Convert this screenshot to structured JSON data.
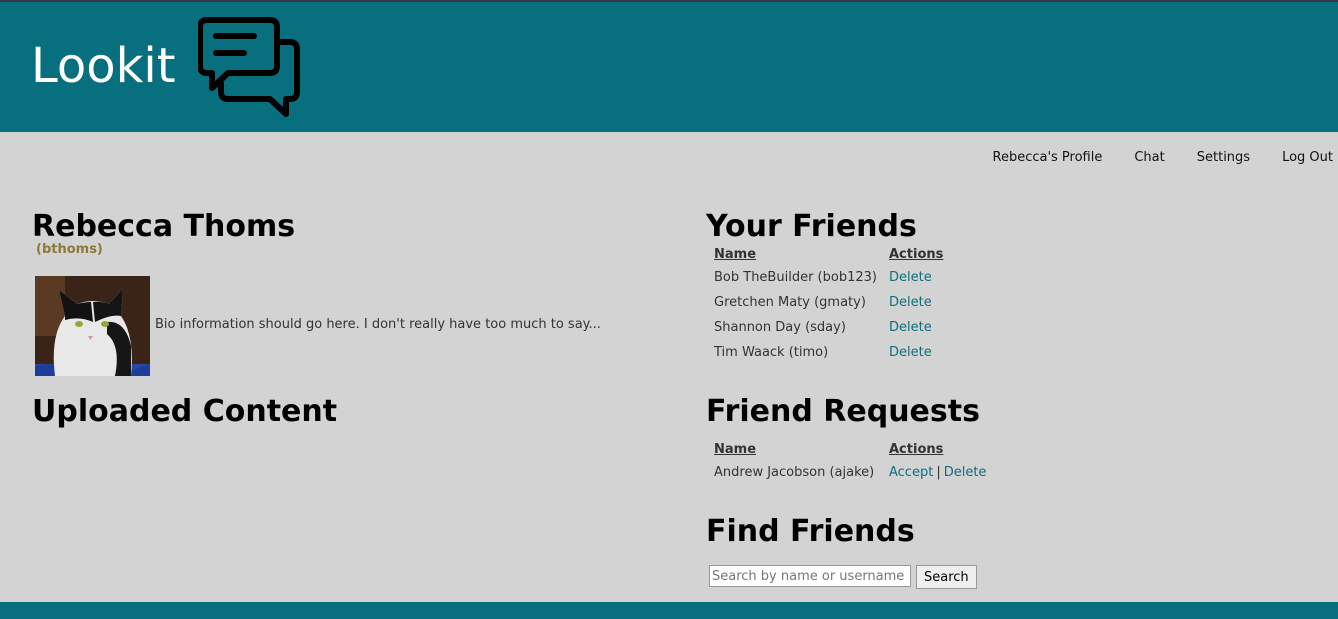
{
  "header": {
    "brand": "Lookit",
    "logo_icon": "chat-bubbles-icon"
  },
  "nav": {
    "items": [
      {
        "label": "Rebecca's Profile"
      },
      {
        "label": "Chat"
      },
      {
        "label": "Settings"
      },
      {
        "label": "Log Out"
      }
    ]
  },
  "profile": {
    "name": "Rebecca Thoms",
    "username": "(bthoms)",
    "bio": "Bio information should go here. I don't really have too much to say..."
  },
  "uploaded": {
    "title": "Uploaded Content"
  },
  "friends": {
    "title": "Your Friends",
    "columns": [
      "Name",
      "Actions"
    ],
    "rows": [
      {
        "name": "Bob TheBuilder (bob123)",
        "action": "Delete"
      },
      {
        "name": "Gretchen Maty (gmaty)",
        "action": "Delete"
      },
      {
        "name": "Shannon Day (sday)",
        "action": "Delete"
      },
      {
        "name": "Tim Waack (timo)",
        "action": "Delete"
      }
    ]
  },
  "requests": {
    "title": "Friend Requests",
    "columns": [
      "Name",
      "Actions"
    ],
    "rows": [
      {
        "name": "Andrew Jacobson (ajake)",
        "accept": "Accept",
        "separator": "|",
        "delete": "Delete"
      }
    ]
  },
  "find": {
    "title": "Find Friends",
    "placeholder": "Search by name or username",
    "button": "Search"
  },
  "colors": {
    "brand_teal": "#076f7e",
    "page_bg": "#d3d3d3",
    "link": "#0d6f7e",
    "username": "#8a7a3a"
  }
}
